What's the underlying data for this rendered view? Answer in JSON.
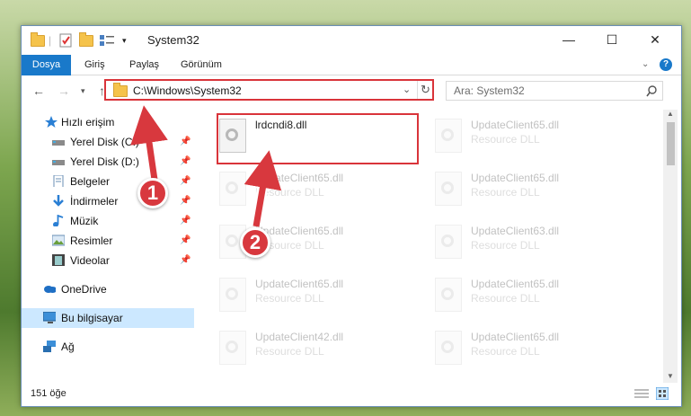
{
  "window": {
    "title": "System32"
  },
  "ribbon": {
    "tabs": [
      "Dosya",
      "Giriş",
      "Paylaş",
      "Görünüm"
    ],
    "help": "?"
  },
  "nav": {
    "address": "C:\\Windows\\System32",
    "search_placeholder": "Ara: System32"
  },
  "sidebar": {
    "items": [
      {
        "label": "Hızlı erişim",
        "icon": "star-icon"
      },
      {
        "label": "Yerel Disk (C:)",
        "icon": "drive-icon"
      },
      {
        "label": "Yerel Disk (D:)",
        "icon": "drive-icon"
      },
      {
        "label": "Belgeler",
        "icon": "documents-icon"
      },
      {
        "label": "İndirmeler",
        "icon": "download-icon"
      },
      {
        "label": "Müzik",
        "icon": "music-icon"
      },
      {
        "label": "Resimler",
        "icon": "pictures-icon"
      },
      {
        "label": "Videolar",
        "icon": "videos-icon"
      },
      {
        "label": "OneDrive",
        "icon": "cloud-icon"
      },
      {
        "label": "Bu bilgisayar",
        "icon": "computer-icon"
      },
      {
        "label": "Ağ",
        "icon": "network-icon"
      }
    ]
  },
  "files": [
    {
      "name": "lrdcndi8.dll",
      "type": ""
    },
    {
      "name": "UpdateClient65.dll",
      "type": "Resource DLL"
    },
    {
      "name": "UpdateClient65.dll",
      "type": "Resource DLL"
    },
    {
      "name": "UpdateClient65.dll",
      "type": "Resource DLL"
    },
    {
      "name": "UpdateClient65.dll",
      "type": "Resource DLL"
    },
    {
      "name": "UpdateClient63.dll",
      "type": "Resource DLL"
    },
    {
      "name": "UpdateClient65.dll",
      "type": "Resource DLL"
    },
    {
      "name": "UpdateClient65.dll",
      "type": "Resource DLL"
    },
    {
      "name": "UpdateClient42.dll",
      "type": "Resource DLL"
    },
    {
      "name": "UpdateClient65.dll",
      "type": "Resource DLL"
    }
  ],
  "status": {
    "count": "151 öğe"
  },
  "callouts": {
    "one": "1",
    "two": "2"
  },
  "colors": {
    "accent": "#1979ca",
    "highlight": "#d9343a",
    "selected": "#cce8ff"
  }
}
